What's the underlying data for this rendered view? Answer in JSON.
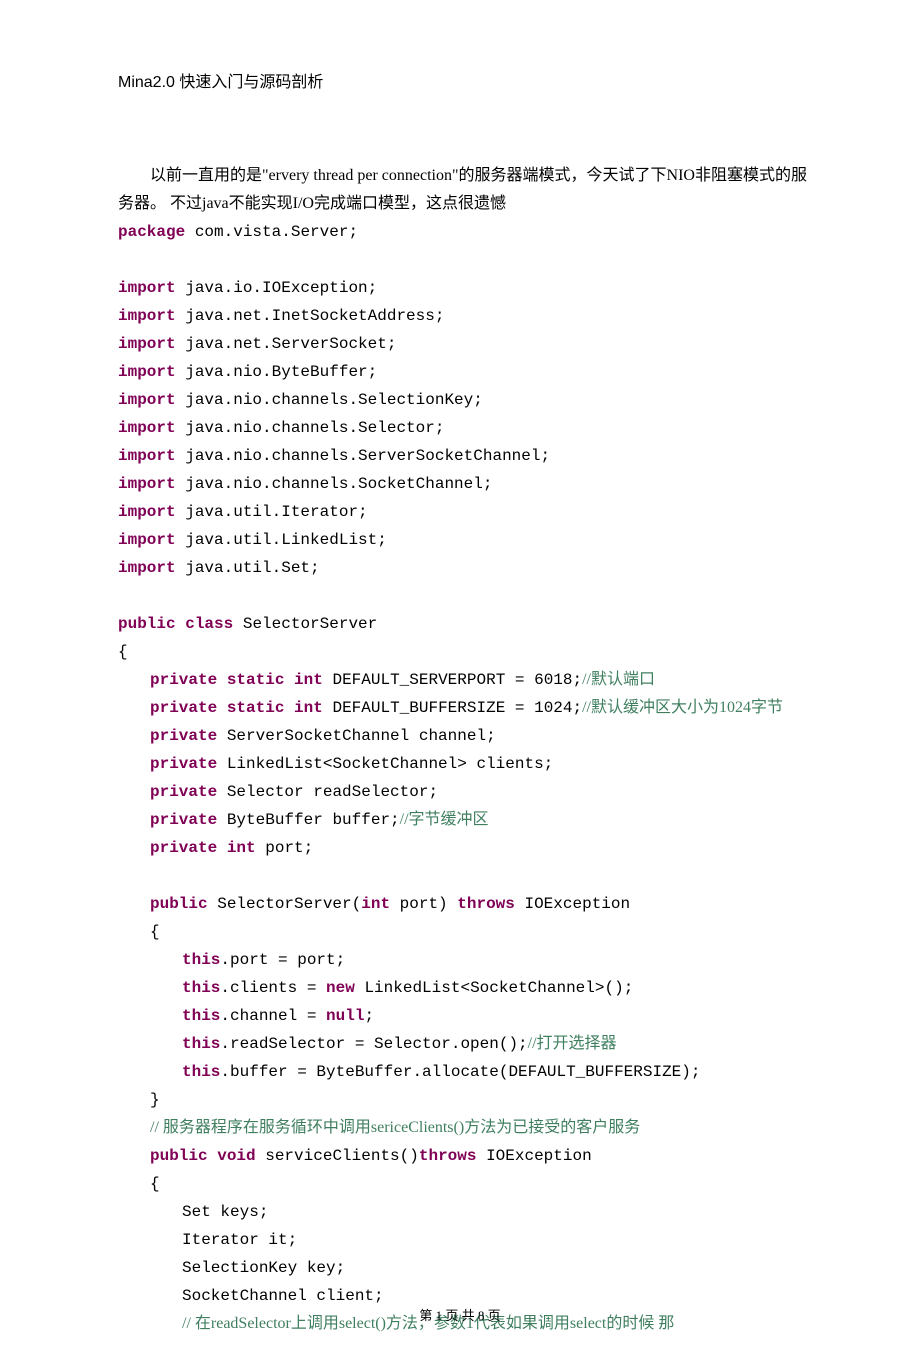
{
  "header": "Mina2.0 快速入门与源码剖析",
  "intro_prefix": "以前一直用的是\"ervery thread per connection\"的服务器端模式，今天试了下NIO非阻塞模式的服务器。  不过java不能实现I/O完成端口模型，这点很遗憾",
  "code": {
    "package": "package",
    "package_name": " com.vista.Server;",
    "import": "import",
    "imports": [
      " java.io.IOException;",
      " java.net.InetSocketAddress;",
      " java.net.ServerSocket;",
      " java.nio.ByteBuffer;",
      " java.nio.channels.SelectionKey;",
      " java.nio.channels.Selector;",
      " java.nio.channels.ServerSocketChannel;",
      " java.nio.channels.SocketChannel;",
      " java.util.Iterator;",
      " java.util.LinkedList;",
      " java.util.Set;"
    ],
    "public": "public",
    "class": "class",
    "classname": " SelectorServer",
    "lbrace": "{",
    "rbrace": "}",
    "private": "private",
    "static": "static",
    "int": "int",
    "serverport_decl": " DEFAULT_SERVERPORT = 6018;",
    "serverport_comment": "//默认端口",
    "buffersize_decl": " DEFAULT_BUFFERSIZE = 1024;",
    "buffersize_comment": "//默认缓冲区大小为1024字节",
    "field_channel": " ServerSocketChannel channel;",
    "field_clients": " LinkedList<SocketChannel> clients;",
    "field_selector": " Selector readSelector;",
    "field_buffer_pre": " ByteBuffer buffer;",
    "field_buffer_comment": "//字节缓冲区",
    "field_port": " port;",
    "ctor_name": " SelectorServer(",
    "ctor_param": " port) ",
    "throws": "throws",
    "ctor_throws": " IOException",
    "this": "this",
    "ctor_l1": ".port = port;",
    "ctor_l2a": ".clients = ",
    "new": "new",
    "ctor_l2b": " LinkedList<SocketChannel>();",
    "ctor_l3a": ".channel = ",
    "null": "null",
    "ctor_l3b": ";",
    "ctor_l4a": ".readSelector = Selector.open();",
    "ctor_l4_comment": "//打开选择器",
    "ctor_l5": ".buffer = ByteBuffer.allocate(DEFAULT_BUFFERSIZE);",
    "method_comment1": " // 服务器程序在服务循环中调用sericeClients()方法为已接受的客户服务",
    "void": "void",
    "method_name": " serviceClients()",
    "method_throws": " IOException",
    "m_l1": "Set keys;",
    "m_l2": "Iterator it;",
    "m_l3": "SelectionKey key;",
    "m_l4": "SocketChannel client;",
    "m_l5": "// 在readSelector上调用select()方法，参数1代表如果调用select的时候 那"
  },
  "footer": "第 1 页   共 8 页"
}
